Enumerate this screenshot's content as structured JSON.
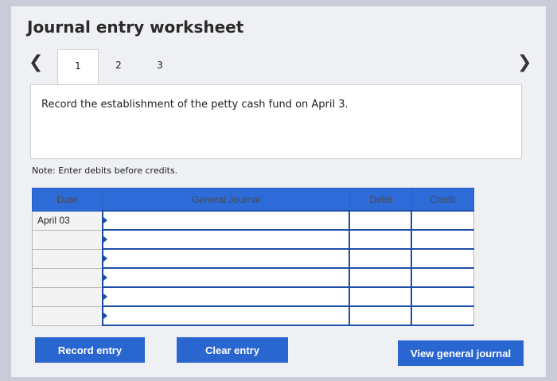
{
  "header": {
    "title": "Journal entry worksheet"
  },
  "nav": {
    "prev_icon": "chevron-left-icon",
    "next_icon": "chevron-right-icon"
  },
  "tabs": [
    {
      "label": "1",
      "active": true
    },
    {
      "label": "2",
      "active": false
    },
    {
      "label": "3",
      "active": false
    }
  ],
  "prompt": {
    "text": "Record the establishment of the petty cash fund on April 3."
  },
  "note": {
    "text": "Note: Enter debits before credits."
  },
  "journal": {
    "columns": [
      "Date",
      "General Journal",
      "Debit",
      "Credit"
    ],
    "rows": [
      {
        "date": "April 03",
        "account": "",
        "debit": "",
        "credit": ""
      },
      {
        "date": "",
        "account": "",
        "debit": "",
        "credit": ""
      },
      {
        "date": "",
        "account": "",
        "debit": "",
        "credit": ""
      },
      {
        "date": "",
        "account": "",
        "debit": "",
        "credit": ""
      },
      {
        "date": "",
        "account": "",
        "debit": "",
        "credit": ""
      },
      {
        "date": "",
        "account": "",
        "debit": "",
        "credit": ""
      }
    ]
  },
  "buttons": {
    "record": "Record entry",
    "clear": "Clear entry",
    "view": "View general journal"
  },
  "colors": {
    "accent": "#2a66cf",
    "header_bg": "#2d6bd9"
  }
}
